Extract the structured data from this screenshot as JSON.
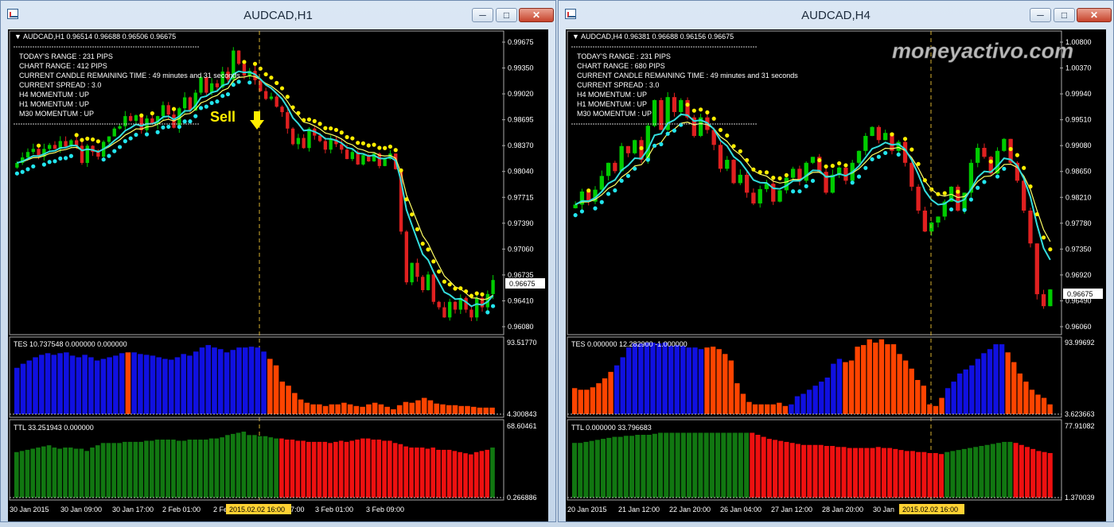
{
  "windows": [
    {
      "id": "h1",
      "title": "AUDCAD,H1",
      "symbol_line": "AUDCAD,H1  0.96514 0.96688 0.96506 0.96675",
      "info_lines": [
        "TODAY'S RANGE : 231 PIPS",
        "CHART RANGE : 412 PIPS",
        "CURRENT CANDLE REMAINING TIME : 49 minutes and 31 seconds",
        "CURRENT SPREAD : 3.0",
        "H4 MOMENTUM : UP",
        "H1 MOMENTUM : UP",
        "M30 MOMENTUM : UP"
      ],
      "sell_label": "Sell",
      "price_axis": [
        "0.99675",
        "0.99350",
        "0.99020",
        "0.98695",
        "0.98370",
        "0.98040",
        "0.97715",
        "0.97390",
        "0.97060",
        "0.96735",
        "0.96410",
        "0.96080"
      ],
      "current_price": "0.96675",
      "tes_label": "TES 10.737548 0.000000 0.000000",
      "tes_scale_top": "93.51770",
      "tes_scale_bottom": "4.300843",
      "ttl_label": "TTL 33.251943 0.000000",
      "ttl_scale_top": "68.60461",
      "ttl_scale_bottom": "0.266886",
      "time_axis": [
        "30 Jan 2015",
        "30 Jan 09:00",
        "30 Jan 17:00",
        "2 Feb 01:00",
        "2 Feb",
        "7:00",
        "3 Feb 01:00",
        "3 Feb 09:00"
      ],
      "cursor_time": "2015.02.02 16:00",
      "chart_data": {
        "type": "candlestick",
        "ylim": [
          0.96,
          0.9985
        ],
        "close": [
          0.9818,
          0.9825,
          0.9832,
          0.9836,
          0.9826,
          0.9836,
          0.9841,
          0.9836,
          0.9846,
          0.9839,
          0.9847,
          0.984,
          0.9818,
          0.984,
          0.9832,
          0.9826,
          0.9845,
          0.9852,
          0.9862,
          0.9865,
          0.9878,
          0.9872,
          0.9879,
          0.986,
          0.9875,
          0.9868,
          0.9878,
          0.9892,
          0.988,
          0.9863,
          0.9888,
          0.9902,
          0.9885,
          0.9908,
          0.9928,
          0.9908,
          0.992,
          0.9915,
          0.9935,
          0.9925,
          0.9962,
          0.9945,
          0.993,
          0.9936,
          0.9924,
          0.991,
          0.99,
          0.9903,
          0.989,
          0.9883,
          0.9862,
          0.9842,
          0.985,
          0.9837,
          0.9862,
          0.9853,
          0.9846,
          0.9835,
          0.9848,
          0.9842,
          0.9835,
          0.9823,
          0.9832,
          0.9816,
          0.9828,
          0.982,
          0.983,
          0.9814,
          0.9823,
          0.983,
          0.981,
          0.973,
          0.9665,
          0.969,
          0.9672,
          0.9655,
          0.9675,
          0.964,
          0.9633,
          0.962,
          0.964,
          0.963,
          0.9645,
          0.963,
          0.962,
          0.9645,
          0.9633,
          0.965,
          0.9668
        ]
      },
      "tes_data": {
        "values": [
          57,
          62,
          66,
          70,
          73,
          75,
          73,
          75,
          76,
          72,
          70,
          73,
          70,
          66,
          68,
          70,
          72,
          75,
          76,
          76,
          74,
          73,
          72,
          70,
          68,
          67,
          70,
          74,
          72,
          77,
          82,
          85,
          82,
          80,
          76,
          79,
          82,
          82,
          83,
          82,
          77,
          68,
          60,
          40,
          35,
          26,
          18,
          14,
          12,
          12,
          10,
          12,
          12,
          14,
          12,
          10,
          9,
          12,
          14,
          12,
          9,
          6,
          11,
          15,
          14,
          17,
          20,
          17,
          13,
          12,
          11,
          11,
          10,
          10,
          9,
          8,
          8,
          8
        ],
        "orange": [
          18,
          41,
          42,
          43,
          44,
          45,
          46,
          47,
          48,
          49,
          50,
          51,
          52,
          53,
          54,
          55,
          56,
          57,
          58,
          59,
          60,
          61,
          62,
          63,
          64,
          65,
          66,
          67,
          68,
          69,
          70,
          71,
          72,
          73,
          74,
          75,
          76,
          77
        ],
        "ymax": 90
      },
      "ttl_data": {
        "values": [
          40,
          41,
          42,
          43,
          44,
          45,
          46,
          44,
          43,
          44,
          44,
          43,
          43,
          41,
          44,
          46,
          48,
          48,
          48,
          48,
          49,
          49,
          49,
          49,
          50,
          50,
          51,
          51,
          51,
          51,
          50,
          50,
          51,
          51,
          51,
          51,
          52,
          52,
          53,
          55,
          56,
          57,
          58,
          55,
          55,
          54,
          54,
          53,
          52,
          52,
          51,
          51,
          50,
          50,
          49,
          49,
          49,
          49,
          48,
          49,
          50,
          49,
          50,
          51,
          52,
          52,
          51,
          51,
          50,
          50,
          48,
          47,
          45,
          44,
          44,
          44,
          43,
          44,
          42,
          42,
          42,
          41,
          40,
          39,
          38,
          40,
          41,
          42,
          44
        ],
        "red": [
          49,
          50,
          51,
          52,
          53,
          54,
          55,
          56,
          57,
          58,
          59,
          60,
          61,
          62,
          63,
          64,
          65,
          66,
          67,
          68,
          69,
          70,
          71,
          72,
          73,
          74,
          75,
          76,
          77,
          78,
          79,
          80,
          81,
          82,
          83,
          84,
          85,
          86,
          87
        ],
        "ymax": 65
      }
    },
    {
      "id": "h4",
      "title": "AUDCAD,H4",
      "symbol_line": "AUDCAD,H4  0.96381 0.96688 0.96156 0.96675",
      "info_lines": [
        "TODAY'S RANGE : 231 PIPS",
        "CHART RANGE : 680 PIPS",
        "CURRENT CANDLE REMAINING TIME : 49 minutes and 31 seconds",
        "CURRENT SPREAD : 3.0",
        "H4 MOMENTUM : UP",
        "H1 MOMENTUM : UP",
        "M30 MOMENTUM : UP"
      ],
      "watermark": "moneyactivo.com",
      "price_axis": [
        "1.00800",
        "1.00370",
        "0.99940",
        "0.99510",
        "0.99080",
        "0.98650",
        "0.98210",
        "0.97780",
        "0.97350",
        "0.96920",
        "0.96490",
        "0.96060"
      ],
      "current_price": "0.96675",
      "tes_label": "TES 0.000000 12.282900 -1.000000",
      "tes_scale_top": "93.99692",
      "tes_scale_bottom": "3.623663",
      "ttl_label": "TTL 0.000000 33.796683",
      "ttl_scale_top": "77.91082",
      "ttl_scale_bottom": "1.370039",
      "time_axis": [
        "20 Jan 2015",
        "21 Jan 12:00",
        "22 Jan 20:00",
        "26 Jan 04:00",
        "27 Jan 12:00",
        "28 Jan 20:00",
        "30 Jan"
      ],
      "cursor_time": "2015.02.02 16:00",
      "chart_data": {
        "type": "candlestick",
        "ylim": [
          0.9595,
          1.0098
        ],
        "close": [
          0.981,
          0.9832,
          0.9815,
          0.9835,
          0.9858,
          0.988,
          0.9866,
          0.9908,
          0.9896,
          0.9918,
          0.9885,
          0.9942,
          0.9985,
          0.9935,
          0.999,
          0.9965,
          0.9985,
          0.9956,
          0.9925,
          0.9956,
          0.9935,
          0.991,
          0.987,
          0.9885,
          0.9846,
          0.986,
          0.983,
          0.9812,
          0.9836,
          0.9845,
          0.9815,
          0.9834,
          0.9855,
          0.987,
          0.985,
          0.988,
          0.989,
          0.9865,
          0.983,
          0.986,
          0.9872,
          0.985,
          0.988,
          0.99,
          0.9925,
          0.994,
          0.9918,
          0.993,
          0.99,
          0.9915,
          0.988,
          0.984,
          0.98,
          0.9765,
          0.978,
          0.979,
          0.9815,
          0.984,
          0.98,
          0.983,
          0.988,
          0.9905,
          0.989,
          0.9862,
          0.99,
          0.992,
          0.988,
          0.985,
          0.98,
          0.9745,
          0.966,
          0.964,
          0.9668
        ]
      },
      "tes_data": {
        "values": [
          32,
          30,
          30,
          33,
          38,
          44,
          52,
          60,
          70,
          82,
          87,
          87,
          88,
          88,
          87,
          88,
          84,
          85,
          84,
          82,
          82,
          80,
          82,
          83,
          80,
          74,
          66,
          38,
          25,
          15,
          12,
          12,
          12,
          12,
          14,
          10,
          12,
          22,
          25,
          30,
          35,
          40,
          45,
          62,
          68,
          64,
          66,
          83,
          85,
          92,
          88,
          92,
          86,
          86,
          74,
          66,
          56,
          42,
          35,
          12,
          10,
          20,
          32,
          40,
          50,
          55,
          60,
          68,
          75,
          80,
          86,
          86,
          76,
          64,
          50,
          40,
          30,
          24,
          20,
          12
        ],
        "orange": [
          0,
          1,
          2,
          3,
          4,
          5,
          6,
          22,
          23,
          24,
          25,
          26,
          27,
          28,
          29,
          30,
          31,
          32,
          33,
          34,
          35,
          45,
          46,
          47,
          48,
          49,
          50,
          51,
          52,
          53,
          54,
          55,
          56,
          57,
          58,
          59,
          60,
          61,
          72,
          73,
          74,
          75,
          76,
          77,
          78,
          79
        ],
        "ymax": 90
      },
      "ttl_data": {
        "values": [
          54,
          54,
          55,
          56,
          57,
          58,
          59,
          60,
          60,
          61,
          61,
          62,
          62,
          62,
          63,
          64,
          64,
          64,
          64,
          64,
          64,
          64,
          64,
          64,
          64,
          64,
          64,
          64,
          64,
          64,
          64,
          64,
          62,
          60,
          58,
          57,
          56,
          55,
          54,
          53,
          52,
          52,
          52,
          52,
          51,
          51,
          50,
          50,
          49,
          49,
          49,
          49,
          49,
          50,
          49,
          49,
          48,
          47,
          46,
          46,
          45,
          45,
          44,
          44,
          43,
          45,
          46,
          47,
          48,
          49,
          50,
          51,
          52,
          53,
          54,
          55,
          55,
          54,
          52,
          50,
          48,
          46,
          45,
          44
        ],
        "red": [
          31,
          32,
          33,
          34,
          35,
          36,
          37,
          38,
          39,
          40,
          41,
          42,
          43,
          44,
          45,
          46,
          47,
          48,
          49,
          50,
          51,
          52,
          53,
          54,
          55,
          56,
          57,
          58,
          59,
          60,
          61,
          62,
          63,
          64,
          77,
          78,
          79,
          80,
          81,
          82,
          83
        ],
        "ymax": 73
      }
    }
  ],
  "colors": {
    "bull": "#00cc00",
    "bear": "#e02020",
    "ma_yellow": "#ffff66",
    "ma_cyan": "#33dddd",
    "psar_cyan": "#22e5ee",
    "psar_yellow": "#ffee00",
    "hist_blue": "#1010e0",
    "hist_orange": "#ff4400",
    "hist_green": "#117711",
    "hist_red": "#ee1010",
    "cursor": "#d6b030"
  }
}
